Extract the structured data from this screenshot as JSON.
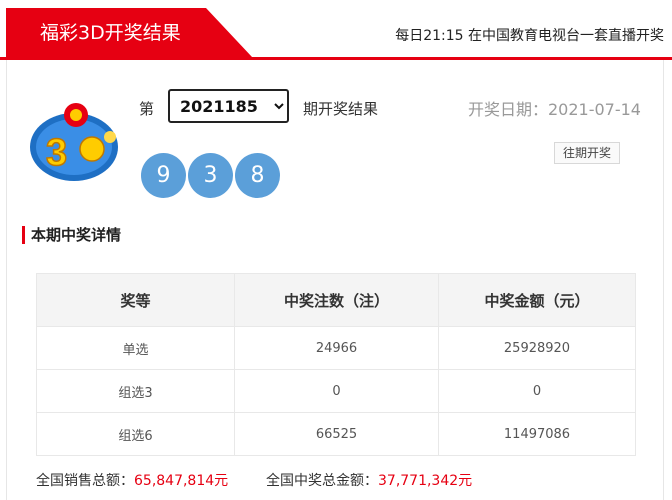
{
  "header": {
    "title": "福彩3D开奖结果",
    "broadcast_note": "每日21:15 在中国教育电视台一套直播开奖"
  },
  "draw": {
    "issue_prefix": "第",
    "issue_selected": "2021185",
    "issue_suffix": "期开奖结果",
    "date_label": "开奖日期：2021-07-14",
    "history_button": "往期开奖",
    "numbers": [
      "9",
      "3",
      "8"
    ]
  },
  "details": {
    "section_title": "本期中奖详情",
    "columns": [
      "奖等",
      "中奖注数（注）",
      "中奖金额（元）"
    ],
    "rows": [
      [
        "单选",
        "24966",
        "25928920"
      ],
      [
        "组选3",
        "0",
        "0"
      ],
      [
        "组选6",
        "66525",
        "11497086"
      ]
    ]
  },
  "summary": {
    "sales_label": "全国销售总额：",
    "sales_value": "65,847,814元",
    "prize_label": "全国中奖总金额：",
    "prize_value": "37,771,342元"
  },
  "colors": {
    "accent": "#e60012",
    "ball": "#5b9fd9"
  }
}
